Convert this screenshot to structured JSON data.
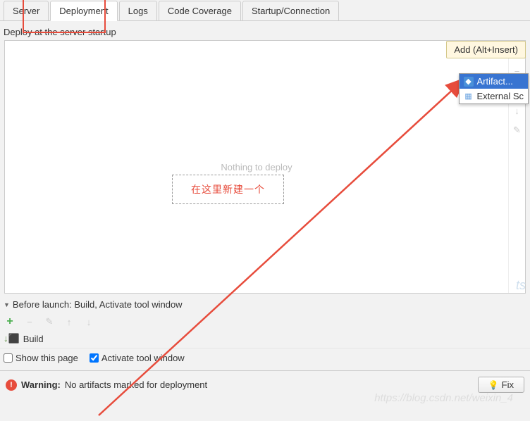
{
  "tabs": {
    "server": "Server",
    "deployment": "Deployment",
    "logs": "Logs",
    "codeCoverage": "Code Coverage",
    "startup": "Startup/Connection"
  },
  "sectionLabel": "Deploy at the server startup",
  "emptyText": "Nothing to deploy",
  "annotation": "在这里新建一个",
  "tooltip": "Add (Alt+Insert)",
  "dropdown": {
    "artifact": "Artifact...",
    "external": "External Sc"
  },
  "beforeLaunch": "Before launch: Build, Activate tool window",
  "buildTask": "Build",
  "checkboxes": {
    "showThisPage": "Show this page",
    "activateToolWindow": "Activate tool window"
  },
  "warning": {
    "label": "Warning:",
    "text": "No artifacts marked for deployment"
  },
  "fixButton": "Fix",
  "watermark": "https://blog.csdn.net/weixin_4",
  "watermark2": "ts"
}
